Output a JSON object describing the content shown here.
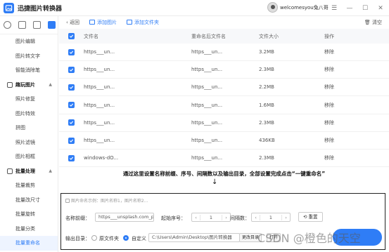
{
  "app": {
    "title": "迅捷图片转换器",
    "username": "welcomesyou兔八哥"
  },
  "window_controls": [
    "menu",
    "minimize",
    "maximize",
    "close"
  ],
  "sidebar": {
    "items_top": [
      "图片编辑",
      "图片转文字",
      "智能消除笔"
    ],
    "group_1": {
      "label": "趣玩图片",
      "items": [
        "照片修复",
        "图片特效",
        "拼图",
        "照片滤镜",
        "图片相框"
      ]
    },
    "group_2": {
      "label": "批量处理",
      "items": [
        "批量裁剪",
        "批量改尺寸",
        "批量旋转",
        "批量分类",
        "批量重命名"
      ]
    },
    "active": "批量重命名"
  },
  "toolbar": {
    "back": "返回",
    "add_image": "添加图片",
    "add_folder": "添加文件夹",
    "clear": "清空"
  },
  "table": {
    "headers": [
      "文件名",
      "重命名后文件名",
      "文件大小",
      "操作"
    ],
    "rows": [
      {
        "name": "https___un...",
        "new_name": "https___un...",
        "size": "3.2MB",
        "op": "移除"
      },
      {
        "name": "https___un...",
        "new_name": "https___un...",
        "size": "2.3MB",
        "op": "移除"
      },
      {
        "name": "https___un...",
        "new_name": "https___un...",
        "size": "2.2MB",
        "op": "移除"
      },
      {
        "name": "https___un...",
        "new_name": "https___un...",
        "size": "1.6MB",
        "op": "移除"
      },
      {
        "name": "https___un...",
        "new_name": "https___un...",
        "size": "2.3MB",
        "op": "移除"
      },
      {
        "name": "https___un...",
        "new_name": "https___un...",
        "size": "436KB",
        "op": "移除"
      },
      {
        "name": "windows-dO...",
        "new_name": "https___un...",
        "size": "2.3MB",
        "op": "移除"
      }
    ]
  },
  "annotation": "通过这里设置名称前缀、序号、间隔数以及输出目录，全部设置完成点击“一键重命名”",
  "arrow": "↓",
  "settings": {
    "hint": "图片命名示例：图片名称1，图片名称2...",
    "prefix_label": "名称前缀：",
    "prefix_value": "https___unsplash.com_p",
    "start_label": "起始序号：",
    "start_value": "1",
    "interval_label": "间隔数：",
    "interval_value": "1",
    "reset": "重置",
    "output_label": "输出目录：",
    "option_source": "原文件夹",
    "option_custom": "自定义",
    "path": "C:\\Users\\Admin\\Desktop\\图片转换器",
    "change_dir": "更改目录",
    "open_folder": "打开"
  },
  "watermark": "CSDN @橙色的天空"
}
